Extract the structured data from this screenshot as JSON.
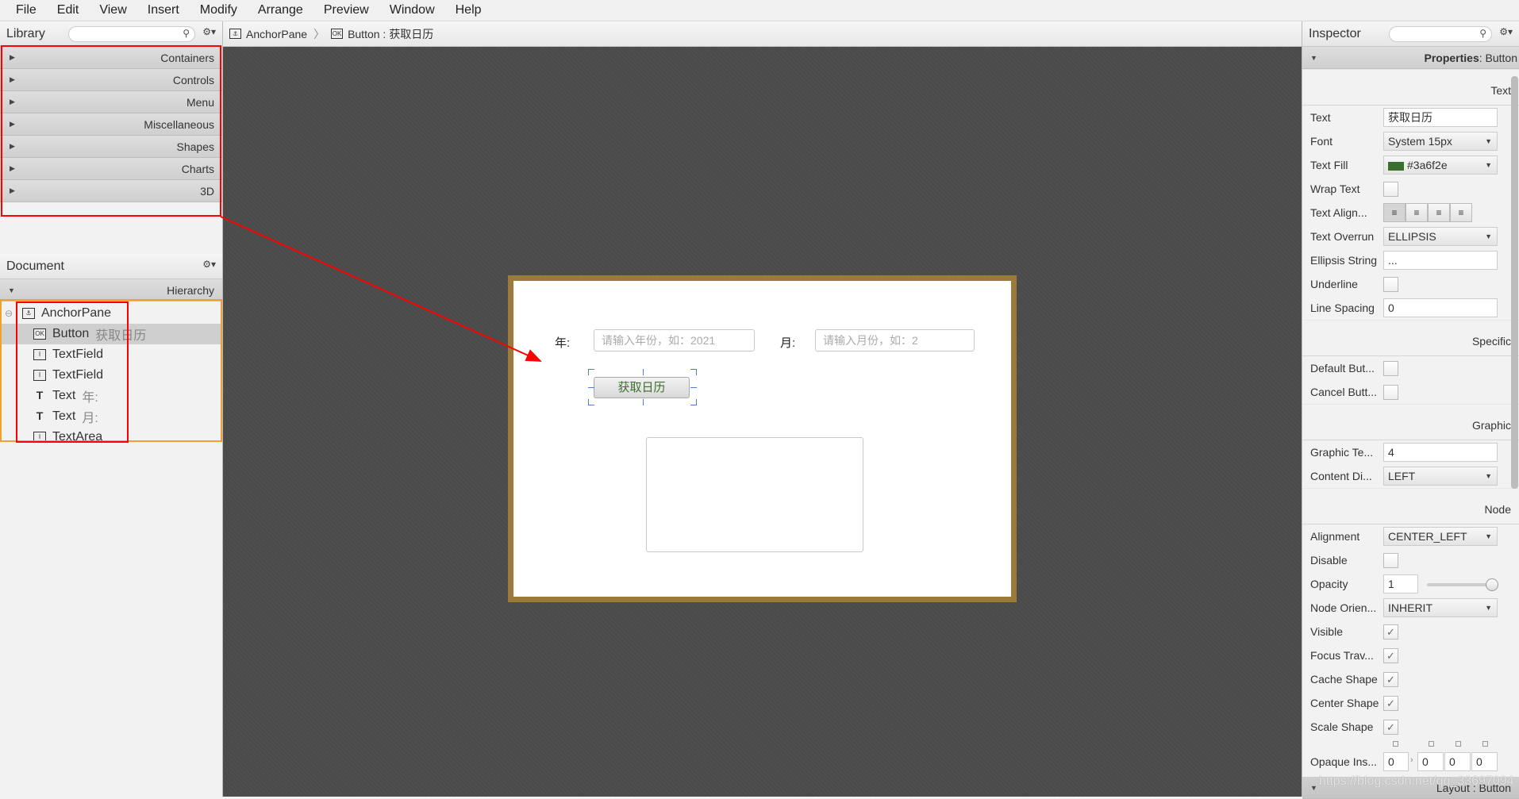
{
  "menu": [
    "File",
    "Edit",
    "View",
    "Insert",
    "Modify",
    "Arrange",
    "Preview",
    "Window",
    "Help"
  ],
  "library": {
    "title": "Library",
    "categories": [
      "Containers",
      "Controls",
      "Menu",
      "Miscellaneous",
      "Shapes",
      "Charts",
      "3D"
    ]
  },
  "document": {
    "title": "Document",
    "hierarchy_label": "Hierarchy",
    "tree": [
      {
        "type": "AnchorPane",
        "icon": "anchor",
        "label": ""
      },
      {
        "type": "Button",
        "icon": "OK",
        "label": "获取日历"
      },
      {
        "type": "TextField",
        "icon": "I",
        "label": ""
      },
      {
        "type": "TextField",
        "icon": "I",
        "label": ""
      },
      {
        "type": "Text",
        "icon": "T",
        "label": "年:"
      },
      {
        "type": "Text",
        "icon": "T",
        "label": "月:"
      },
      {
        "type": "TextArea",
        "icon": "I",
        "label": ""
      }
    ]
  },
  "breadcrumb": [
    "AnchorPane",
    "Button : 获取日历"
  ],
  "canvas": {
    "year_label": "年:",
    "year_placeholder": "请输入年份，如：2021",
    "month_label": "月:",
    "month_placeholder": "请输入月份，如：2",
    "button_label": "获取日历"
  },
  "inspector": {
    "title": "Inspector",
    "properties_prefix": "Properties",
    "properties_target": " : Button",
    "sections": {
      "text": "Text",
      "specific": "Specific",
      "graphic": "Graphic",
      "node": "Node"
    },
    "text": {
      "text": [
        "Text",
        "获取日历"
      ],
      "font": [
        "Font",
        "System 15px"
      ],
      "fill": [
        "Text Fill",
        "#3a6f2e"
      ],
      "wrap": [
        "Wrap Text",
        false
      ],
      "align": "Text Align...",
      "overrun": [
        "Text Overrun",
        "ELLIPSIS"
      ],
      "ellipsis": [
        "Ellipsis String",
        "..."
      ],
      "underline": [
        "Underline",
        false
      ],
      "spacing": [
        "Line Spacing",
        "0"
      ]
    },
    "specific": {
      "default": [
        "Default But...",
        false
      ],
      "cancel": [
        "Cancel Butt...",
        false
      ]
    },
    "graphic": {
      "gap": [
        "Graphic Te...",
        "4"
      ],
      "content": [
        "Content Di...",
        "LEFT"
      ]
    },
    "node": {
      "alignment": [
        "Alignment",
        "CENTER_LEFT"
      ],
      "disable": [
        "Disable",
        false
      ],
      "opacity": [
        "Opacity",
        "1"
      ],
      "opacity_value": 1,
      "orient": [
        "Node Orien...",
        "INHERIT"
      ],
      "visible": [
        "Visible",
        true
      ],
      "focus": [
        "Focus Trav...",
        true
      ],
      "cache": [
        "Cache Shape",
        true
      ],
      "center": [
        "Center Shape",
        true
      ],
      "scale": [
        "Scale Shape",
        true
      ],
      "opaque": [
        "Opaque Ins...",
        "0",
        "0",
        "0",
        "0"
      ]
    },
    "layout_bar": "Layout : Button"
  },
  "watermark": "https://blog.csdn.net/qq_33697094",
  "colors": {
    "text_fill": "#3a6f2e",
    "anchor_border": "#9c7a3c",
    "annotation": "#ff0000",
    "selection": "#f0a030"
  }
}
